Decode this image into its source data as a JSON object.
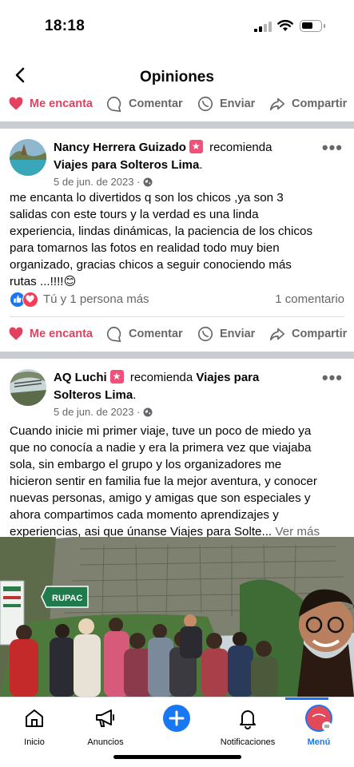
{
  "status": {
    "time": "18:18"
  },
  "header": {
    "title": "Opiniones"
  },
  "actions": {
    "love": "Me encanta",
    "comment": "Comentar",
    "send": "Enviar",
    "share": "Compartir"
  },
  "posts": [
    {
      "author": "Nancy Herrera Guizado",
      "recommends": "recomienda",
      "page": "Viajes para Solteros Lima",
      "period": ".",
      "date": "5 de jun. de 2023 ·",
      "lines": [
        "me encanta lo divertidos q son los chicos ,ya son 3",
        "salidas con este tours y la verdad es una linda",
        "experiencia, lindas dinámicas, la paciencia de los chicos",
        "para tomarnos las fotos en realidad todo muy bien",
        "organizado, gracias chicos a seguir conociendo más",
        "rutas ...!!!!😊"
      ],
      "reactions_text": "Tú y 1 persona más",
      "comments_text": "1 comentario"
    },
    {
      "author": "AQ Luchi",
      "recommends": "recomienda",
      "page_part1": "Viajes para",
      "page_part2": "Solteros Lima",
      "period": ".",
      "date": "5 de jun. de 2023 ·",
      "lines": [
        "Cuando inicie mi primer viaje, tuve un poco de miedo ya",
        "que no conocía a nadie y era la primera vez que viajaba",
        "sola, sin embargo el grupo y los organizadores me",
        "hicieron sentir en familia fue la mejor aventura, y conocer",
        "nuevas personas, amigo y amigas que son especiales y",
        "ahora compartimos cada momento  aprendizajes y"
      ],
      "last_line": "experiencias, asi que únanse  Viajes para Solte...",
      "see_more": "Ver más"
    }
  ],
  "photo_sign": "RUPAC",
  "nav": {
    "items": [
      "Inicio",
      "Anuncios",
      "Notificaciones",
      "Menú"
    ],
    "accent": "#1877f2"
  },
  "colors": {
    "love": "#e4405f",
    "brand": "#1877f2",
    "badge": "#f2507a"
  }
}
